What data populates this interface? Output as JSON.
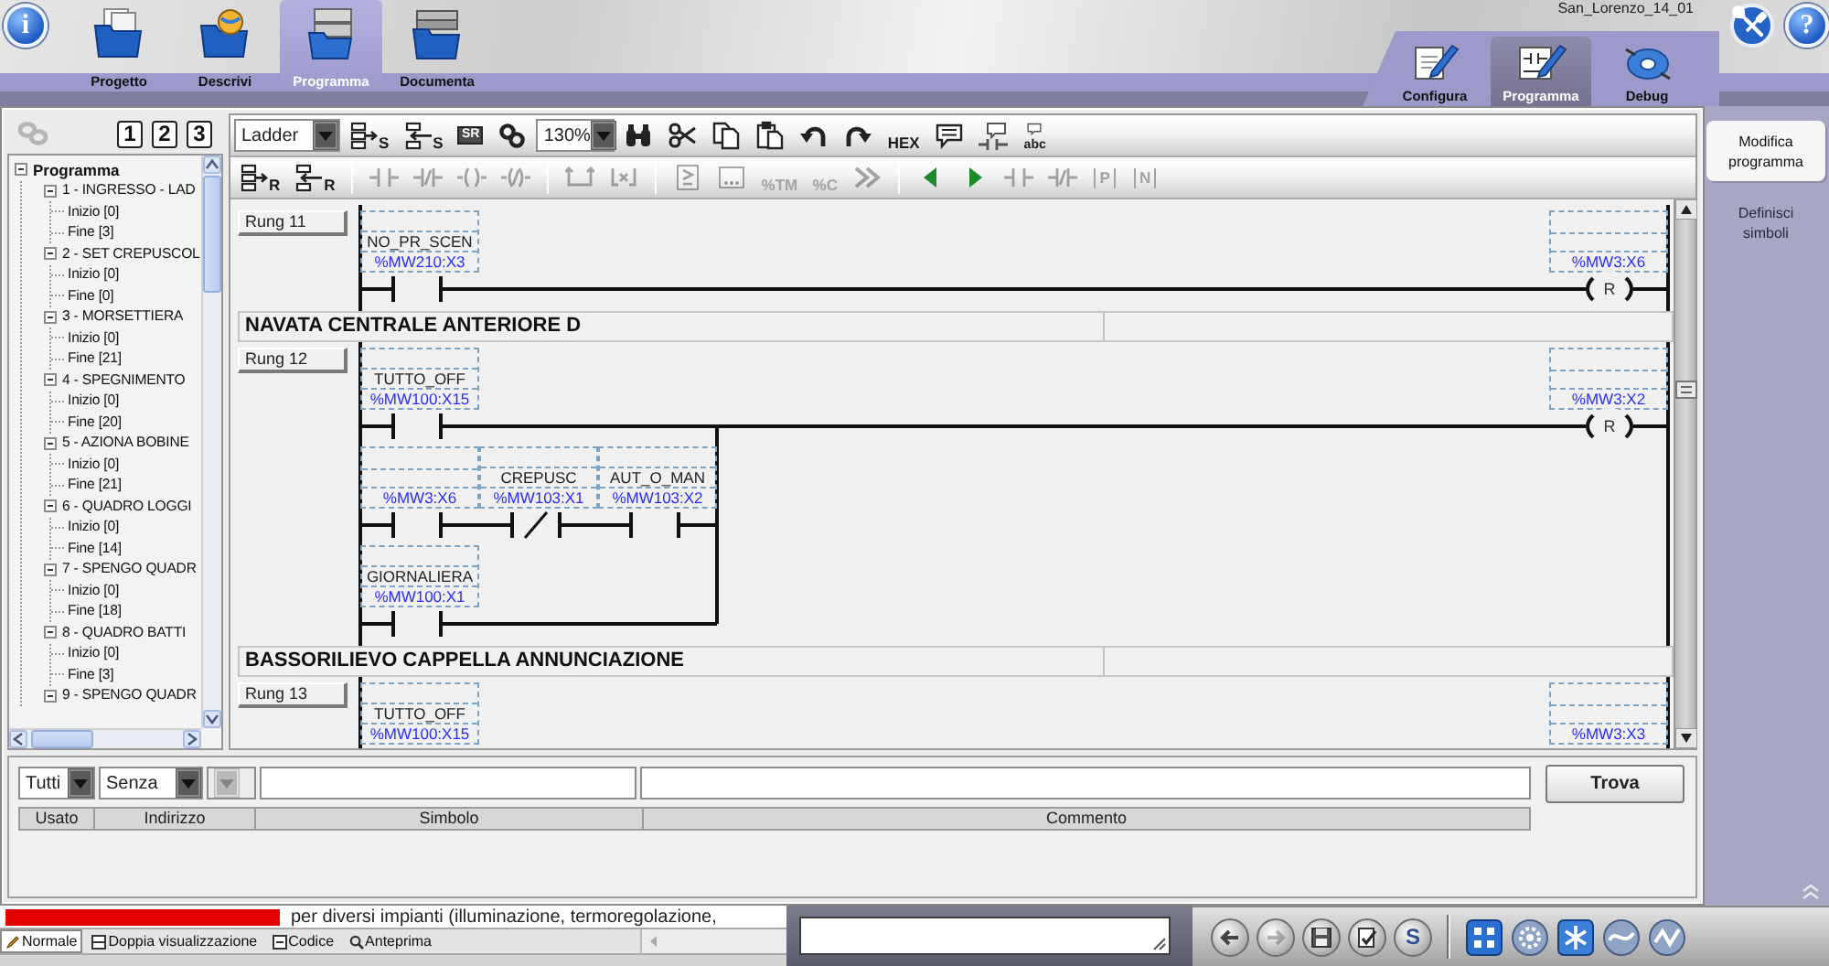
{
  "header": {
    "info_button": "i",
    "tabs": [
      {
        "label": "Progetto",
        "selected": false
      },
      {
        "label": "Descrivi",
        "selected": false
      },
      {
        "label": "Programma",
        "selected": true
      },
      {
        "label": "Documenta",
        "selected": false
      }
    ],
    "project_name": "San_Lorenzo_14_01",
    "help_button": "?",
    "mode_tabs": [
      {
        "label": "Configura",
        "selected": false
      },
      {
        "label": "Programma",
        "selected": true
      },
      {
        "label": "Debug",
        "selected": false
      }
    ]
  },
  "program_panel": {
    "link_button": {
      "disabled": true
    },
    "view_buttons": [
      "1",
      "2",
      "3"
    ],
    "tree": {
      "label": "Programma",
      "expanded": true,
      "children": [
        {
          "label": "1 - INGRESSO - LAD",
          "expanded": true,
          "children": [
            {
              "label": "Inizio [0]"
            },
            {
              "label": "Fine [3]"
            }
          ]
        },
        {
          "label": "2 - SET CREPUSCOL",
          "expanded": true,
          "children": [
            {
              "label": "Inizio [0]"
            },
            {
              "label": "Fine [0]"
            }
          ]
        },
        {
          "label": "3 - MORSETTIERA",
          "expanded": true,
          "children": [
            {
              "label": "Inizio [0]"
            },
            {
              "label": "Fine [21]"
            }
          ]
        },
        {
          "label": "4 - SPEGNIMENTO",
          "expanded": true,
          "children": [
            {
              "label": "Inizio [0]"
            },
            {
              "label": "Fine [20]"
            }
          ]
        },
        {
          "label": "5 - AZIONA BOBINE",
          "expanded": true,
          "children": [
            {
              "label": "Inizio [0]"
            },
            {
              "label": "Fine [21]"
            }
          ]
        },
        {
          "label": "6 - QUADRO LOGGI",
          "expanded": true,
          "children": [
            {
              "label": "Inizio [0]"
            },
            {
              "label": "Fine [14]"
            }
          ]
        },
        {
          "label": "7 - SPENGO QUADR",
          "expanded": true,
          "children": [
            {
              "label": "Inizio [0]"
            },
            {
              "label": "Fine [18]"
            }
          ]
        },
        {
          "label": "8 - QUADRO BATTI",
          "expanded": true,
          "children": [
            {
              "label": "Inizio [0]"
            },
            {
              "label": "Fine [3]"
            }
          ]
        },
        {
          "label": "9 - SPENGO QUADR",
          "expanded": true
        }
      ]
    }
  },
  "toolbar": {
    "language": "Ladder",
    "row1_left": [
      {
        "kind": "setrow",
        "label": "S",
        "disabled": false
      },
      {
        "kind": "setrow2",
        "label": "S",
        "disabled": false
      },
      {
        "kind": "sr",
        "label": "SR",
        "disabled": false
      },
      {
        "kind": "link",
        "disabled": false
      }
    ],
    "zoom": "130%",
    "row1_right": [
      {
        "kind": "find",
        "disabled": false
      },
      {
        "kind": "cut",
        "disabled": false
      },
      {
        "kind": "copy",
        "disabled": false
      },
      {
        "kind": "paste",
        "disabled": false
      },
      {
        "kind": "undo",
        "disabled": false
      },
      {
        "kind": "redo",
        "disabled": false
      },
      {
        "kind": "hex",
        "label": "HEX",
        "disabled": false
      },
      {
        "kind": "comment",
        "disabled": false
      },
      {
        "kind": "notecontact",
        "disabled": false
      },
      {
        "kind": "notetext",
        "label": "abc",
        "disabled": false
      }
    ],
    "row2": [
      [
        {
          "kind": "rowreset",
          "label": "R",
          "disabled": false
        },
        {
          "kind": "rowreset2",
          "label": "R",
          "disabled": false
        }
      ],
      [
        {
          "kind": "contact",
          "disabled": true
        },
        {
          "kind": "nccontact",
          "disabled": true
        },
        {
          "kind": "coil",
          "disabled": true
        },
        {
          "kind": "nccoil",
          "disabled": true
        }
      ],
      [
        {
          "kind": "branch",
          "disabled": true
        },
        {
          "kind": "unbranch",
          "disabled": true
        }
      ],
      [
        {
          "kind": "compare",
          "disabled": true
        },
        {
          "kind": "block",
          "disabled": true
        },
        {
          "kind": "timer",
          "label": "%TM",
          "disabled": true
        },
        {
          "kind": "counter",
          "label": "%C",
          "disabled": true
        },
        {
          "kind": "jump",
          "disabled": true
        }
      ],
      [
        {
          "kind": "left",
          "disabled": false
        },
        {
          "kind": "right",
          "disabled": false
        },
        {
          "kind": "contact",
          "disabled": true
        },
        {
          "kind": "nccontact",
          "disabled": true
        },
        {
          "kind": "pulse",
          "label": "P",
          "disabled": true
        },
        {
          "kind": "pulse",
          "label": "N",
          "disabled": true
        }
      ]
    ]
  },
  "ladder": {
    "items": [
      {
        "kind": "rung",
        "label": "Rung 11",
        "branches": [
          [
            {
              "kind": "no",
              "symbol": "NO_PR_SCEN",
              "address": "%MW210:X3"
            }
          ]
        ],
        "coil": {
          "kind": "reset",
          "letter": "R",
          "address": "%MW3:X6"
        }
      },
      {
        "kind": "section",
        "title": "NAVATA CENTRALE ANTERIORE D"
      },
      {
        "kind": "rung",
        "label": "Rung 12",
        "branches": [
          [
            {
              "kind": "no",
              "symbol": "TUTTO_OFF",
              "address": "%MW100:X15"
            }
          ],
          [
            {
              "kind": "no",
              "address": "%MW3:X6"
            },
            {
              "kind": "nc",
              "symbol": "CREPUSC",
              "address": "%MW103:X1"
            },
            {
              "kind": "no",
              "symbol": "AUT_O_MAN",
              "address": "%MW103:X2"
            }
          ],
          [
            {
              "kind": "no",
              "symbol": "GIORNALIERA",
              "address": "%MW100:X1"
            }
          ]
        ],
        "coil": {
          "kind": "reset",
          "letter": "R",
          "address": "%MW3:X2"
        }
      },
      {
        "kind": "section",
        "title": "BASSORILIEVO CAPPELLA ANNUNCIAZIONE"
      },
      {
        "kind": "rung",
        "label": "Rung 13",
        "branches": [
          [
            {
              "symbol": "TUTTO_OFF",
              "address": "%MW100:X15"
            }
          ]
        ],
        "coil": {
          "address": "%MW3:X3"
        }
      }
    ]
  },
  "side_tabs": [
    {
      "label": "Modifica programma",
      "selected": true
    },
    {
      "label": "Definisci simboli",
      "selected": false
    }
  ],
  "search": {
    "filters": [
      {
        "value": "Tutti",
        "disabled": false
      },
      {
        "value": "Senza",
        "disabled": false
      },
      {
        "disabled": true
      }
    ],
    "button": "Trova",
    "columns": [
      "Usato",
      "Indirizzo",
      "Simbolo",
      "Commento"
    ]
  },
  "document": {
    "text": "per diversi impianti (illuminazione, termoregolazione,",
    "view_tabs": [
      {
        "label": "Normale",
        "selected": true
      },
      {
        "label": "Doppia visualizzazione",
        "selected": false
      },
      {
        "label": "Codice",
        "selected": false
      },
      {
        "label": "Anteprima",
        "selected": false
      }
    ]
  },
  "nav_buttons": [
    {
      "kind": "back",
      "disabled": false
    },
    {
      "kind": "forward",
      "disabled": true
    },
    {
      "kind": "save",
      "disabled": false
    },
    {
      "kind": "verify",
      "disabled": false
    },
    {
      "kind": "symbol",
      "label": "S",
      "disabled": false
    }
  ]
}
